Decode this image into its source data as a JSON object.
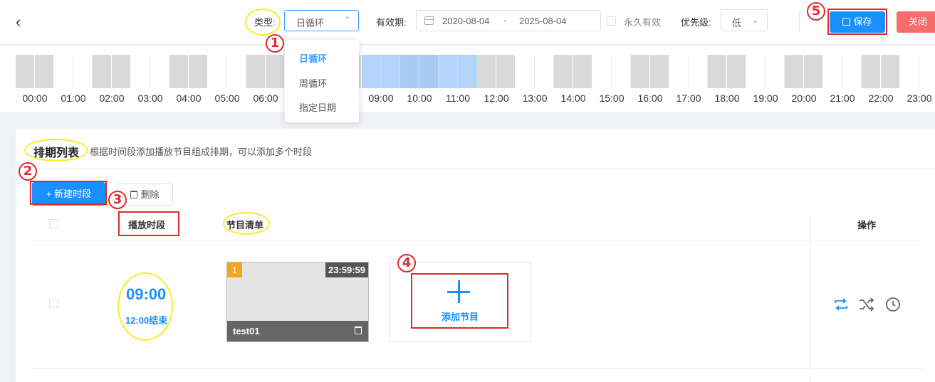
{
  "header": {
    "back_icon": "chevron-left-icon",
    "type_label": "类型:",
    "type_value": "日循环",
    "validity_label": "有效期:",
    "date_start": "2020-08-04",
    "date_sep": "-",
    "date_end": "2025-08-04",
    "permanent_label": "永久有效",
    "priority_label": "优先级:",
    "priority_value": "低",
    "save_label": "保存",
    "close_label": "关闭"
  },
  "type_dropdown": {
    "options": [
      "日循环",
      "周循环",
      "指定日期"
    ],
    "selected": "日循环"
  },
  "timeline": {
    "hours": [
      "00:00",
      "01:00",
      "02:00",
      "03:00",
      "04:00",
      "05:00",
      "06:00",
      "09:00",
      "10:00",
      "11:00",
      "12:00",
      "13:00",
      "14:00",
      "15:00",
      "16:00",
      "17:00",
      "18:00",
      "19:00",
      "20:00",
      "21:00",
      "22:00",
      "23:00"
    ],
    "selected_range": [
      "09:00",
      "12:00"
    ]
  },
  "schedule": {
    "title": "排期列表",
    "description": "根据时间段添加播放节目组成排期，可以添加多个时段",
    "new_button": "+ 新建时段",
    "delete_button": "删除",
    "columns": {
      "period": "播放时段",
      "programs": "节目清单",
      "actions": "操作"
    },
    "rows": [
      {
        "start": "09:00",
        "end": "12:00结束",
        "program": {
          "index": "1",
          "duration": "23:59:59",
          "name": "test01"
        },
        "add_label": "添加节目"
      }
    ]
  },
  "annotations": [
    "1",
    "2",
    "3",
    "4",
    "5"
  ],
  "colors": {
    "primary": "#1890ff",
    "danger": "#f56c6c",
    "highlight": "#f5ec2a",
    "marker": "#e02b2b"
  }
}
